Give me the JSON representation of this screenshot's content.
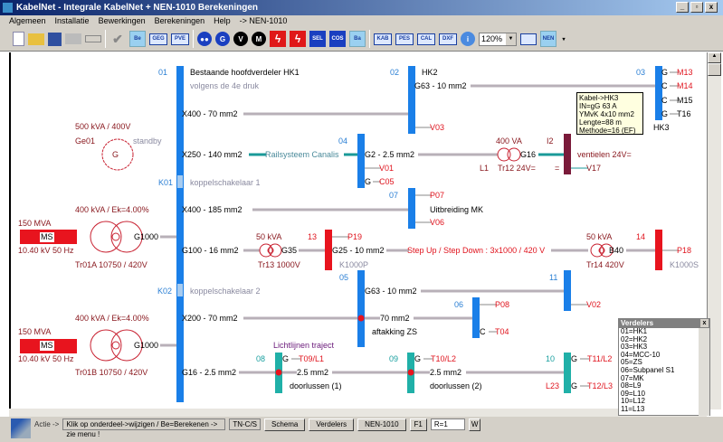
{
  "window": {
    "title": "KabelNet - Integrale KabelNet + NEN-1010  Berekeningen",
    "min": "_",
    "max": "▫",
    "close": "x"
  },
  "menu": [
    "Algemeen",
    "Installatie",
    "Bewerkingen",
    "Berekeningen",
    "Help",
    "-> NEN-1010"
  ],
  "toolbar": {
    "be": "Be",
    "geg": "GEG",
    "pve": "PVE",
    "g": "G",
    "v": "V",
    "m": "M",
    "sel": "SEL",
    "cos": "COS",
    "ba": "Ba",
    "kab": "KAB",
    "pes": "PES",
    "cal": "CAL",
    "dxf": "DXF",
    "zoom": "120%",
    "nen": "NEN"
  },
  "diagram": {
    "b01": {
      "id": "01",
      "title": "Bestaande hoofdverdeler HK1",
      "sub": "volgens de 4e druk"
    },
    "c1": "X400 - 70 mm2",
    "c2": "X250 - 140 mm2",
    "rail": "Railsysteem Canalis",
    "k01": "K01",
    "k01l": "koppelschakelaar 1",
    "c3": "X400 - 185 mm2",
    "c4": "G100 - 16 mm2",
    "k02": "K02",
    "k02l": "koppelschakelaar 2",
    "c5": "X200 - 70 mm2",
    "c6": "G16 - 2.5 mm2",
    "gen": {
      "power": "500 kVA / 400V",
      "id": "Ge01",
      "mode": "standby",
      "sym": "G"
    },
    "tra": {
      "power": "400 kVA / Ek=4.00%",
      "grid": "150 MVA",
      "ms": "MS",
      "out": "G1000",
      "volt": "10.40 kV  50 Hz",
      "name": "Tr01A 10750 / 420V"
    },
    "trb": {
      "power": "400 kVA / Ek=4.00%",
      "grid": "150 MVA",
      "ms": "MS",
      "out": "G1000",
      "volt": "10.40 kV  50 Hz",
      "name": "Tr01B 10750 / 420V"
    },
    "b02": {
      "id": "02",
      "name": "HK2",
      "cable": "G63 - 10 mm2",
      "out": "V03"
    },
    "b03": {
      "id": "03",
      "name": "HK3",
      "rows": [
        [
          "G",
          "M13"
        ],
        [
          "C",
          "M14"
        ],
        [
          "C",
          "M15"
        ],
        [
          "G",
          "T16"
        ]
      ]
    },
    "tooltip": [
      "Kabel->HK3",
      "IN=gG 63 A",
      "YMvK 4x10 mm2",
      "Lengte=88 m",
      "Methode=16  (EF)"
    ],
    "b04": {
      "id": "04",
      "cable": "G2 - 2.5 mm2",
      "v01": "V01",
      "g": "G",
      "c05": "C05"
    },
    "tr12": {
      "power": "400 VA",
      "l": "L1",
      "name": "Tr12 24V=",
      "out": "G16"
    },
    "i2": {
      "id": "I2",
      "name": "ventielen 24V=",
      "eq": "=",
      "out": "V17"
    },
    "b07": {
      "id": "07",
      "p": "P07",
      "name": "Uitbreiding MK",
      "v": "V06"
    },
    "tr13": {
      "power": "50 kVA",
      "name": "Tr13 1000V",
      "out": "G35"
    },
    "b13": {
      "id": "13",
      "p": "P19",
      "cable": "G25 - 10 mm2",
      "k": "K1000P"
    },
    "stepup": "Step Up / Step Down  : 3x1000 / 420 V",
    "tr14": {
      "power": "50 kVA",
      "name": "Tr14 420V",
      "out": "B40"
    },
    "b14": {
      "id": "14",
      "p": "P18",
      "k": "K1000S"
    },
    "b05": {
      "id": "05",
      "cable": "G63 - 10 mm2",
      "c2": "70 mm2",
      "name": "aftakking ZS"
    },
    "b11": {
      "id": "11",
      "v": "V02"
    },
    "b06": {
      "id": "06",
      "p": "P08",
      "c": "C",
      "t": "T04"
    },
    "light": "Lichtlijnen traject",
    "b08": {
      "id": "08",
      "g": "G",
      "t": "T09/L1",
      "cable": "2.5 mm2",
      "name": "doorlussen (1)"
    },
    "b09": {
      "id": "09",
      "g": "G",
      "t": "T10/L2",
      "cable": "2.5 mm2",
      "name": "doorlussen (2)"
    },
    "b10": {
      "id": "10",
      "g": "G",
      "t": "T11/L2",
      "l": "L23",
      "g2": "G",
      "t2": "T12/L3"
    }
  },
  "verdelers": {
    "title": "Verdelers",
    "items": [
      "01=HK1",
      "02=HK2",
      "03=HK3",
      "04=MCC-10",
      "05=ZS",
      "06=Subpanel S1",
      "07=MK",
      "08=L9",
      "09=L10",
      "10=L12",
      "11=L13"
    ]
  },
  "status": {
    "actie": "Actie ->",
    "msg": "Klik op onderdeel->wijzigen / Be=Berekenen -> zie menu !",
    "net": "TN-C/S",
    "schema": "Schema",
    "verdelers": "Verdelers",
    "nen": "NEN-1010",
    "f1": "F1",
    "r": "R=1",
    "w": "W"
  },
  "colors": {
    "bus": "#1a7fe8",
    "red": "#e8141e",
    "teal": "#20b0a8",
    "maroon": "#7a1a3a"
  }
}
